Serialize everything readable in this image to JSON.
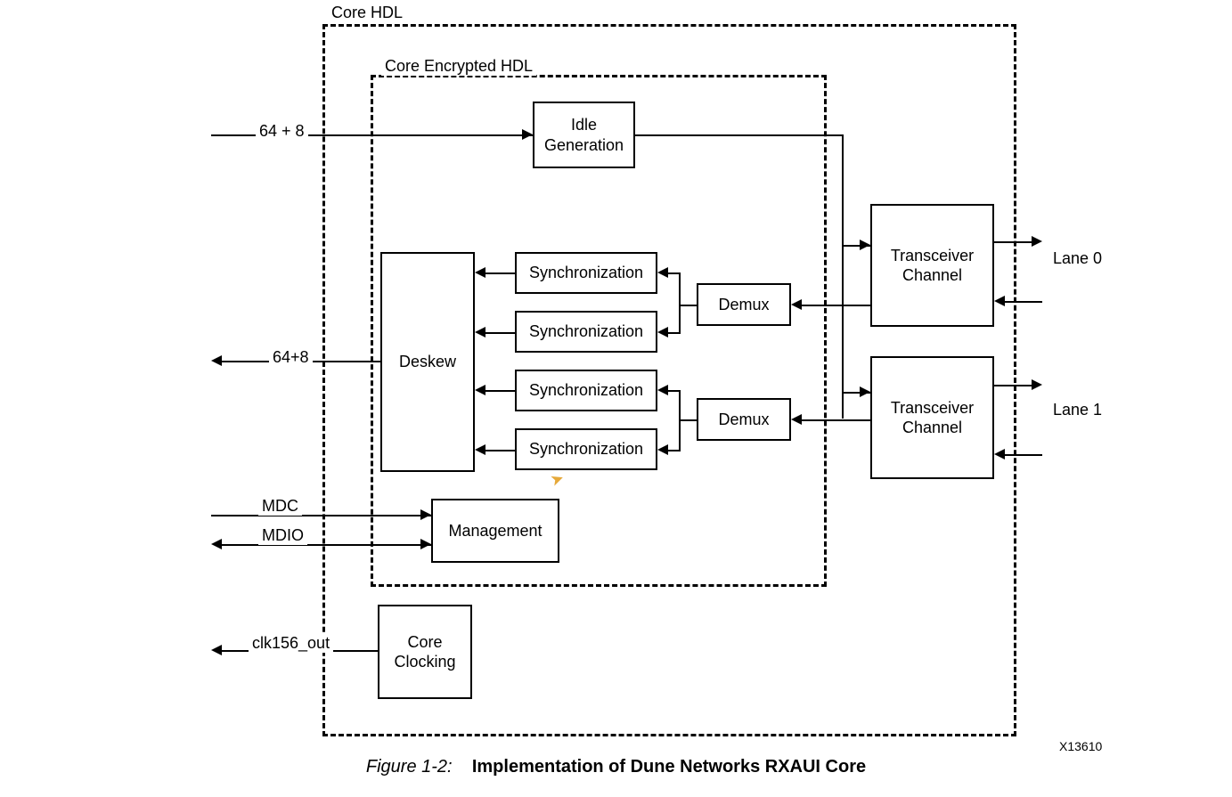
{
  "outer_label": "Core HDL",
  "inner_label": "Core Encrypted HDL",
  "blocks": {
    "idle": "Idle\nGeneration",
    "deskew": "Deskew",
    "sync": "Synchronization",
    "demux": "Demux",
    "management": "Management",
    "clocking": "Core\nClocking",
    "transceiver": "Transceiver\nChannel"
  },
  "signals": {
    "in_top": "64 + 8",
    "out_deskew": "64+8",
    "mdc": "MDC",
    "mdio": "MDIO",
    "clk": "clk156_out"
  },
  "lanes": {
    "lane0": "Lane 0",
    "lane1": "Lane 1"
  },
  "figure_ref": "X13610",
  "caption_num": "Figure 1-2:",
  "caption_title": "Implementation of Dune Networks RXAUI Core"
}
